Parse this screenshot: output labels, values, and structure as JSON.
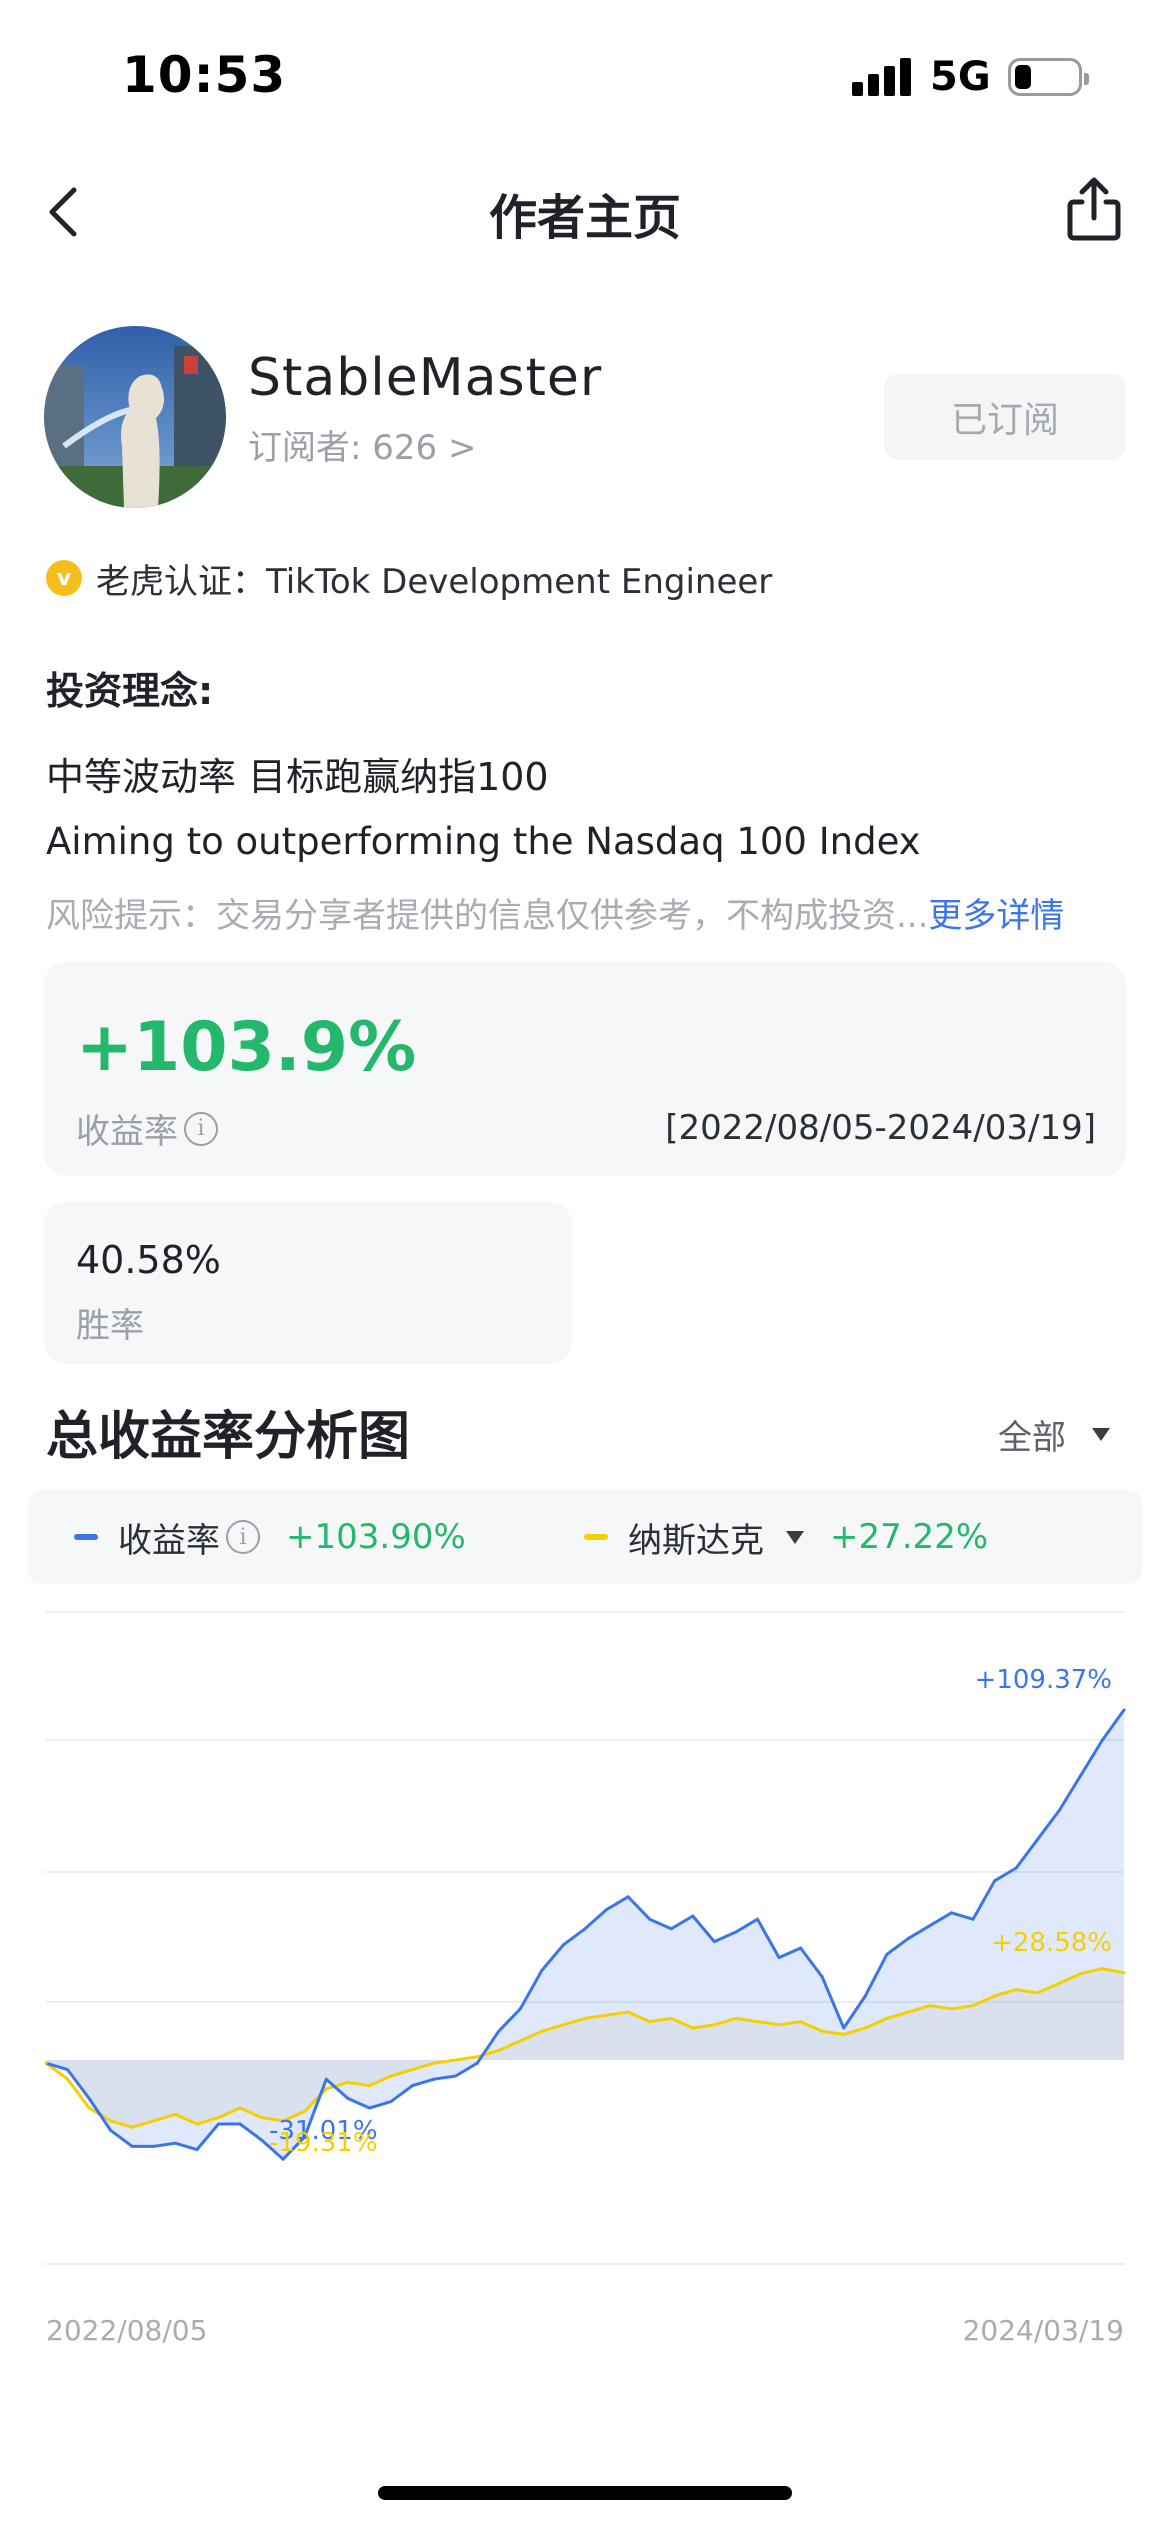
{
  "status_bar": {
    "time": "10:53",
    "network": "5G"
  },
  "nav": {
    "title": "作者主页"
  },
  "profile": {
    "username": "StableMaster",
    "subscribers": "订阅者: 626 >",
    "subscribe_button": "已订阅",
    "verify_badge": "v",
    "verification": "老虎认证：TikTok Development Engineer"
  },
  "philosophy": {
    "heading": "投资理念:",
    "line1": "中等波动率 目标跑赢纳指100",
    "line2": "Aiming to outperforming the Nasdaq 100 Index",
    "risk_text": "风险提示：交易分享者提供的信息仅供参考，不构成投资...",
    "more_link": "更多详情"
  },
  "return_card": {
    "value": "+103.9%",
    "label": "收益率",
    "range": "[2022/08/05-2024/03/19]"
  },
  "winrate_card": {
    "value": "40.58%",
    "label": "胜率"
  },
  "chart_section": {
    "title": "总收益率分析图",
    "range_selector": "全部",
    "legend": [
      {
        "name": "收益率",
        "value": "+103.90%",
        "color": "#3b76e8"
      },
      {
        "name": "纳斯达克",
        "value": "+27.22%",
        "color": "#f5d000"
      }
    ]
  },
  "colors": {
    "accent_blue": "#3b76e8",
    "accent_yellow": "#f5d000",
    "positive_green": "#23b86b"
  },
  "icons": {
    "back": "chevron-left-icon",
    "share": "share-icon",
    "info": "info-icon",
    "verified": "verified-badge-icon"
  },
  "chart_data": {
    "type": "area",
    "x_start_label": "2022/08/05",
    "x_end_label": "2024/03/19",
    "ylim": [
      -40,
      120
    ],
    "grid": true,
    "series": [
      {
        "name": "收益率",
        "color": "#3b76e8",
        "x": [
          0,
          2,
          4,
          6,
          8,
          10,
          12,
          14,
          16,
          18,
          20,
          22,
          24,
          26,
          28,
          30,
          32,
          34,
          36,
          38,
          40,
          42,
          44,
          46,
          48,
          50,
          52,
          54,
          56,
          58,
          60,
          62,
          64,
          66,
          68,
          70,
          72,
          74,
          76,
          78,
          80,
          82,
          84,
          86,
          88,
          90,
          92,
          94,
          96,
          98,
          100
        ],
        "values": [
          -1,
          -3,
          -12,
          -22,
          -27,
          -27,
          -26,
          -28,
          -20,
          -20,
          -25,
          -31,
          -24,
          -6,
          -12,
          -15,
          -13,
          -8,
          -6,
          -5,
          -1,
          9,
          16,
          28,
          36,
          41,
          47,
          51,
          44,
          41,
          45,
          37,
          40,
          44,
          32,
          35,
          26,
          10,
          20,
          33,
          38,
          42,
          46,
          44,
          56,
          60,
          69,
          78,
          89,
          100,
          109.37
        ],
        "annotations": [
          {
            "x": 26,
            "text": "-31.01%"
          },
          {
            "x": 100,
            "text": "+109.37%"
          }
        ]
      },
      {
        "name": "纳斯达克",
        "color": "#f5d000",
        "x": [
          0,
          2,
          4,
          6,
          8,
          10,
          12,
          14,
          16,
          18,
          20,
          22,
          24,
          26,
          28,
          30,
          32,
          34,
          36,
          38,
          40,
          42,
          44,
          46,
          48,
          50,
          52,
          54,
          56,
          58,
          60,
          62,
          64,
          66,
          68,
          70,
          72,
          74,
          76,
          78,
          80,
          82,
          84,
          86,
          88,
          90,
          92,
          94,
          96,
          98,
          100
        ],
        "values": [
          -1,
          -6,
          -15,
          -19,
          -21,
          -19,
          -17,
          -20,
          -18,
          -15,
          -18,
          -19,
          -16,
          -9,
          -7,
          -8,
          -5,
          -3,
          -1,
          0,
          1,
          3,
          6,
          9,
          11,
          13,
          14,
          15,
          12,
          13,
          10,
          11,
          13,
          12,
          11,
          12,
          9,
          8,
          10,
          13,
          15,
          17,
          16,
          17,
          20,
          22,
          21,
          24,
          27,
          28.58,
          27.22
        ],
        "annotations": [
          {
            "x": 26,
            "text": "-19.31%"
          },
          {
            "x": 100,
            "text": "+28.58%"
          }
        ]
      }
    ]
  }
}
